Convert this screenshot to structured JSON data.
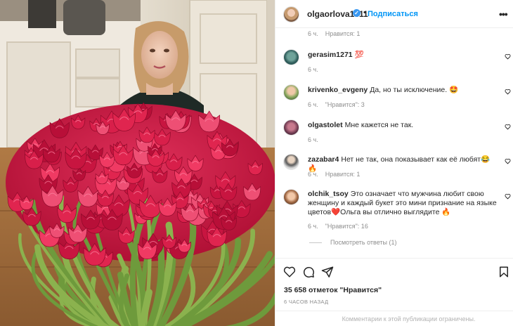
{
  "post": {
    "username": "olgaorlova1311",
    "verified_icon": "verified-badge-icon",
    "separator": "•",
    "follow_label": "Подписаться",
    "more_icon_text": "•••",
    "photo_subject": "bouquet-photo"
  },
  "top_meta": {
    "time": "6 ч.",
    "likes": "Нравится: 1"
  },
  "comments": [
    {
      "user": "gerasim1271",
      "text": "💯",
      "time": "6 ч.",
      "likes": ""
    },
    {
      "user": "krivenko_evgeny",
      "text": "Да, но ты исключение. 🤩",
      "time": "6 ч.",
      "likes": "\"Нравится\": 3"
    },
    {
      "user": "olgastolet",
      "text": "Мне кажется не так.",
      "time": "6 ч.",
      "likes": ""
    },
    {
      "user": "zazabar4",
      "text": "Нет не так, она показывает как её любят😂🔥",
      "time": "6 ч.",
      "likes": "Нравится: 1"
    },
    {
      "user": "olchik_tsoy",
      "text": "Это означает что мужчина любит свою женщину и каждый букет это мини признание на языке цветов❤️Ольга вы отлично выглядите 🔥",
      "time": "6 ч.",
      "likes": "\"Нравится\": 16"
    }
  ],
  "view_replies": "Посмотреть ответы (1)",
  "actions": {
    "like_icon": "heart-icon",
    "comment_icon": "comment-icon",
    "share_icon": "send-icon",
    "save_icon": "bookmark-icon"
  },
  "likes_count": "35 658 отметок \"Нравится\"",
  "timestamp": "6 ЧАСОВ НАЗАД",
  "comments_restricted": "Комментарии к этой публикации ограничены.",
  "colors": {
    "accent": "#0095f6",
    "text": "#262626",
    "muted": "#8e8e8e",
    "tulip": "#d81f4a"
  }
}
